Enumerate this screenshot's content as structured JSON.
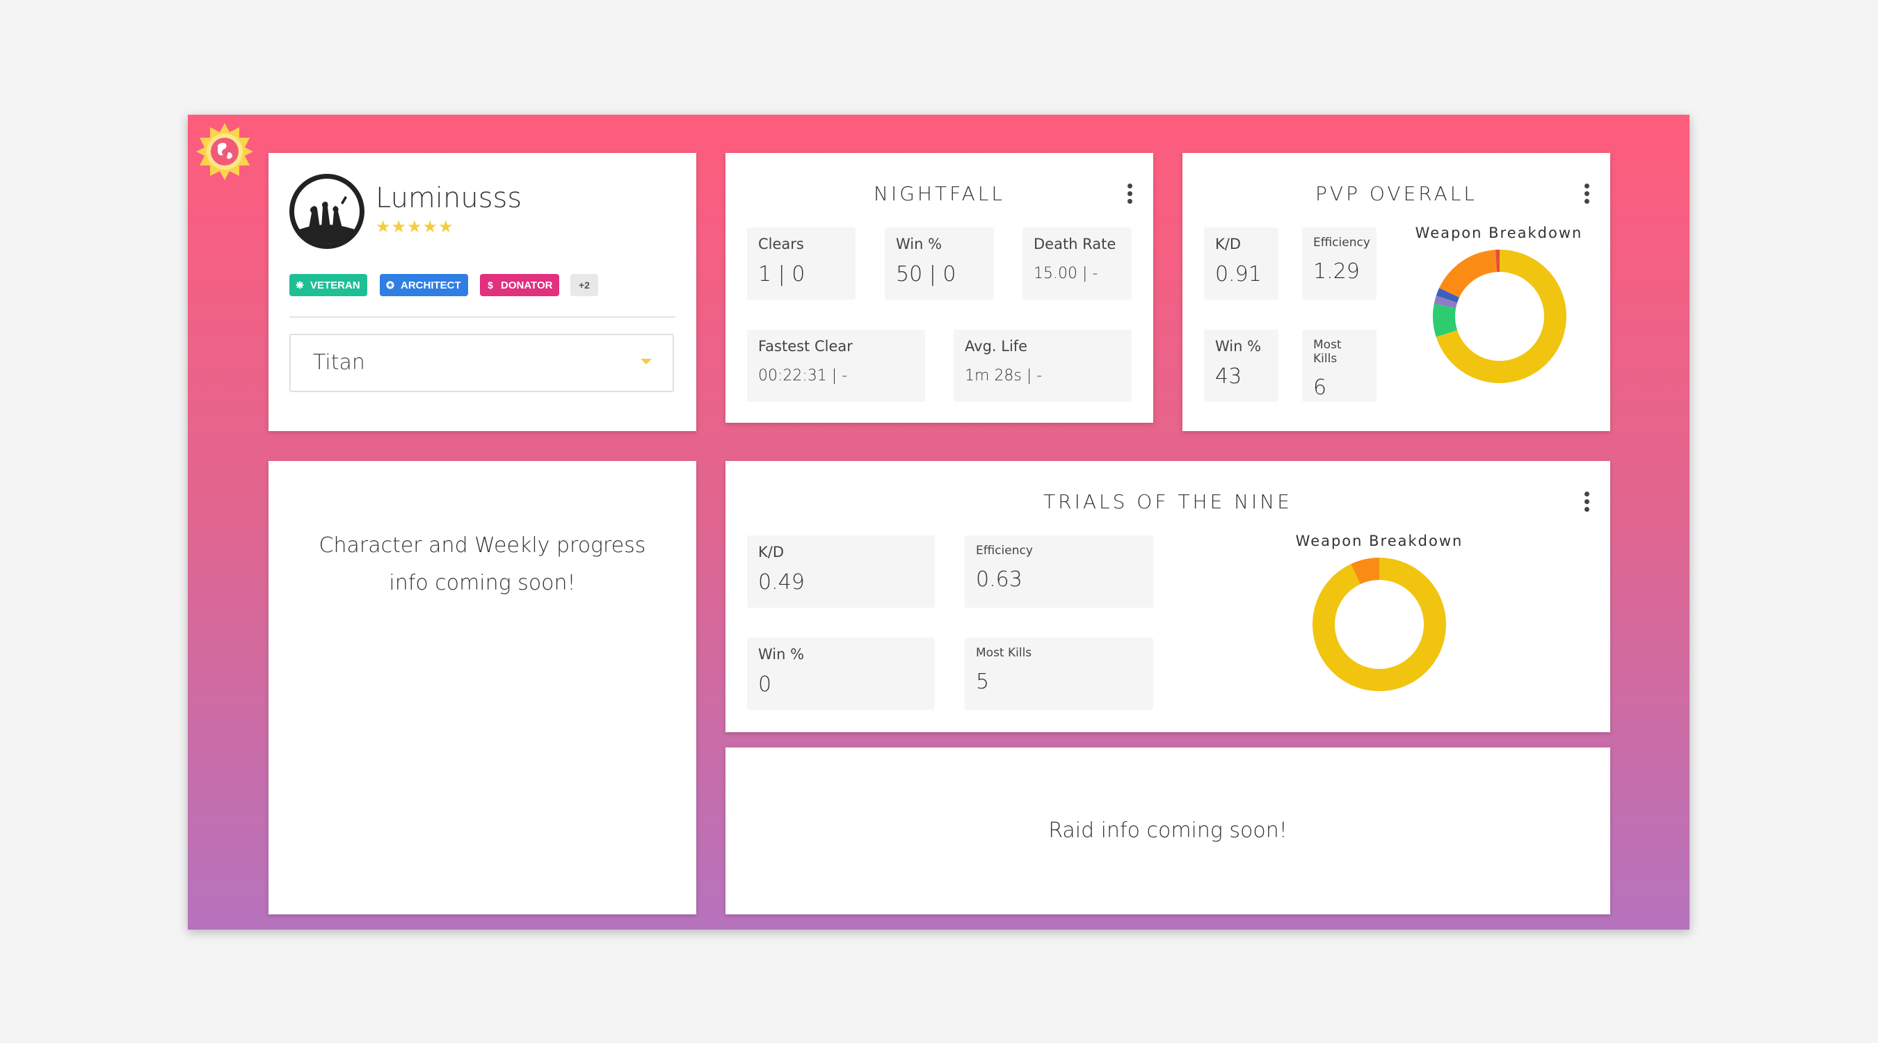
{
  "profile": {
    "name": "Luminusss",
    "stars": "★★★★★",
    "badges": [
      {
        "label": "VETERAN",
        "icon": "❋",
        "color": "#1fbf95"
      },
      {
        "label": "ARCHITECT",
        "icon": "✪",
        "color": "#2f7ee3"
      },
      {
        "label": "DONATOR",
        "icon": "$",
        "color": "#e0307e"
      }
    ],
    "more_badges": "+2",
    "selected_class": "Titan",
    "avatar_icon": "guardians-silhouette-icon"
  },
  "nightfall": {
    "title": "NIGHTFALL",
    "stats": [
      {
        "label": "Clears",
        "value": "1 | 0"
      },
      {
        "label": "Win %",
        "value": "50 | 0"
      },
      {
        "label": "Death Rate",
        "value": "15.00 | -"
      },
      {
        "label": "Fastest Clear",
        "value": "00:22:31 | -"
      },
      {
        "label": "Avg. Life",
        "value": "1m 28s | -"
      }
    ]
  },
  "pvp": {
    "title": "PVP OVERALL",
    "stats": [
      {
        "label": "K/D",
        "value": "0.91"
      },
      {
        "label": "Efficiency",
        "value": "1.29"
      },
      {
        "label": "Win %",
        "value": "43"
      },
      {
        "label": "Most Kills",
        "value": "6"
      }
    ],
    "breakdown_title": "Weapon Breakdown"
  },
  "trials": {
    "title": "TRIALS OF THE NINE",
    "stats": [
      {
        "label": "K/D",
        "value": "0.49"
      },
      {
        "label": "Efficiency",
        "value": "0.63"
      },
      {
        "label": "Win %",
        "value": "0"
      },
      {
        "label": "Most Kills",
        "value": "5"
      }
    ],
    "breakdown_title": "Weapon Breakdown"
  },
  "character_placeholder": {
    "line1": "Character and Weekly progress",
    "line2": "info coming soon!"
  },
  "raid_placeholder": "Raid info coming soon!",
  "chart_data": [
    {
      "type": "pie",
      "title": "Weapon Breakdown",
      "series": [
        {
          "values": [
            70,
            8,
            2,
            2,
            17,
            1
          ]
        }
      ],
      "colors": [
        "#f1c40f",
        "#2ecc71",
        "#8e7cc3",
        "#3f5fbf",
        "#fa8c16",
        "#e74c3c"
      ]
    },
    {
      "type": "pie",
      "title": "Weapon Breakdown",
      "series": [
        {
          "values": [
            93,
            7
          ]
        }
      ],
      "colors": [
        "#f1c40f",
        "#fa8c16"
      ]
    }
  ]
}
